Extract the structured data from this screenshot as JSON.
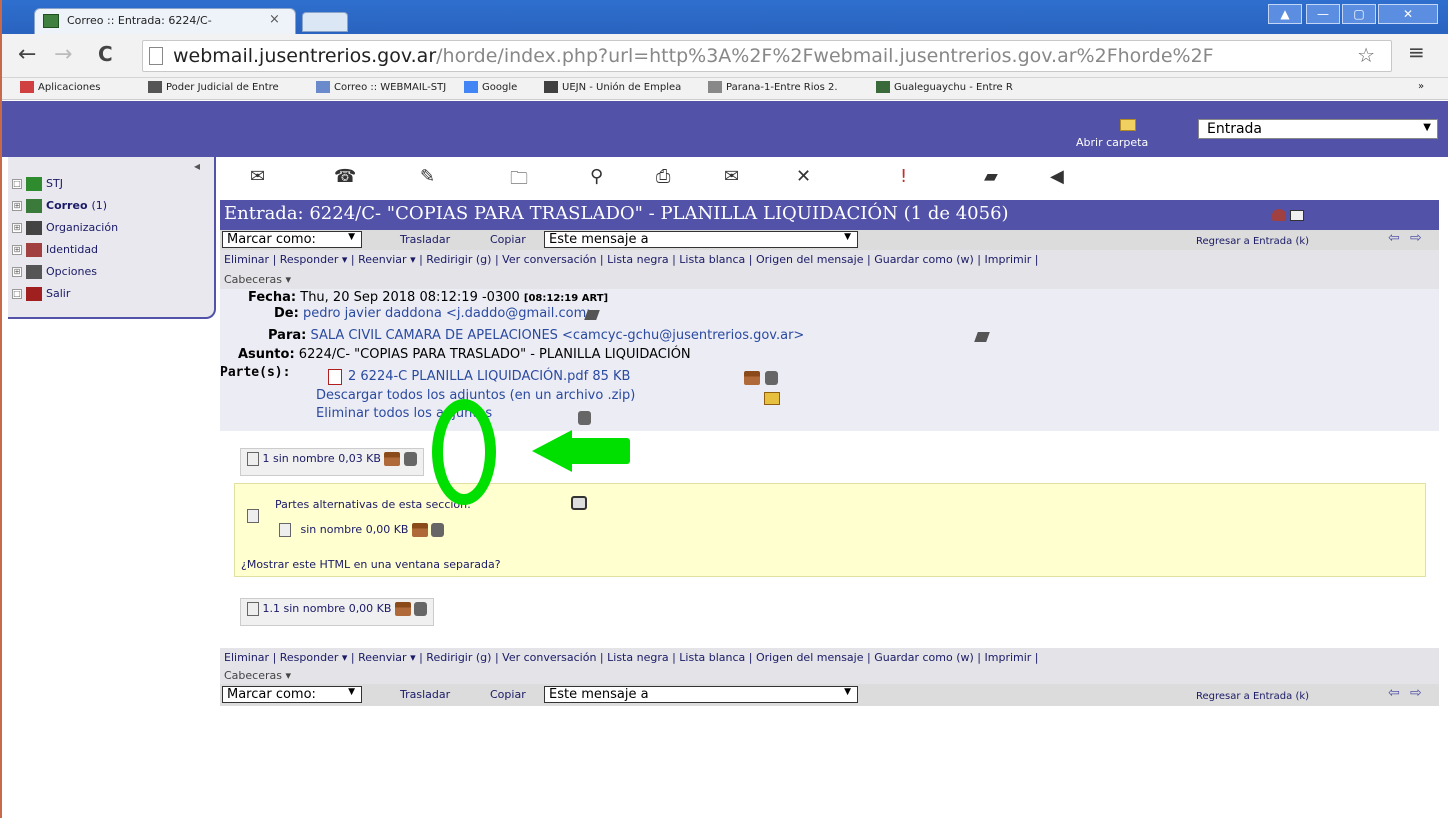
{
  "browser": {
    "tab_title": "Correo :: Entrada: 6224/C-",
    "tab_close": "×",
    "url_host": "webmail.jusentrerios.gov.ar",
    "url_rest": "/horde/index.php?url=http%3A%2F%2Fwebmail.jusentrerios.gov.ar%2Fhorde%2F",
    "back": "←",
    "forward": "→",
    "reload": "C",
    "star": "☆",
    "menu": "≡",
    "win_min": "—",
    "win_max": "▢",
    "win_close": "✕",
    "win_user": "▲"
  },
  "bookmarks": [
    {
      "label": "Aplicaciones",
      "color": "#d04040"
    },
    {
      "label": "Poder Judicial de Entre",
      "color": "#555555"
    },
    {
      "label": "Correo :: WEBMAIL-STJ",
      "color": "#6a8acb"
    },
    {
      "label": "Google",
      "color": "#4285f4"
    },
    {
      "label": "UEJN - Unión de Emplea",
      "color": "#404040"
    },
    {
      "label": "Parana-1-Entre Rios 2.",
      "color": "#888888"
    },
    {
      "label": "Gualeguaychu - Entre R",
      "color": "#3a6a3a"
    }
  ],
  "bookmarks_more": "»",
  "folder": {
    "open_label": "Abrir carpeta",
    "selected": "Entrada",
    "arrow": "▼"
  },
  "sidebar": {
    "items": [
      {
        "label": "STJ",
        "icon": "stj-icon",
        "toggle": "□"
      },
      {
        "label": "Correo",
        "count": "(1)",
        "icon": "mail-folder-icon",
        "toggle": "⊞"
      },
      {
        "label": "Organización",
        "icon": "organization-icon",
        "toggle": "⊞"
      },
      {
        "label": "Identidad",
        "icon": "identity-icon",
        "toggle": "⊞"
      },
      {
        "label": "Opciones",
        "icon": "options-icon",
        "toggle": "⊞"
      },
      {
        "label": "Salir",
        "icon": "logout-icon",
        "toggle": "□"
      }
    ]
  },
  "toolbar_icons": [
    "✉",
    "☎",
    "✎",
    "🗀",
    "⚲",
    "⎙",
    "✉",
    "✕",
    "!",
    "▰",
    "◀"
  ],
  "message": {
    "title": "Entrada: 6224/C- \"COPIAS PARA TRASLADO\" - PLANILLA LIQUIDACIÓN (1 de 4056)",
    "mark_as": "Marcar como:",
    "move": "Trasladar",
    "copy": "Copiar",
    "target": "Este mensaje a",
    "back_to": "Regresar a Entrada (k)",
    "prev": "⇦",
    "next": "⇨",
    "actions": "Eliminar | Responder ▾ | Reenviar ▾ | Redirigir (g) | Ver conversación | Lista negra | Lista blanca | Origen del mensaje | Guardar como (w) | Imprimir |",
    "headers_toggle": "Cabeceras ▾",
    "fecha_label": "Fecha:",
    "fecha": "Thu, 20 Sep 2018 08:12:19 -0300",
    "fecha_local": "[08:12:19 ART]",
    "de_label": "De:",
    "de": "pedro javier daddona <j.daddo@gmail.com>",
    "para_label": "Para:",
    "para": "SALA CIVIL CAMARA DE APELACIONES <camcyc-gchu@jusentrerios.gov.ar>",
    "asunto_label": "Asunto:",
    "asunto": "6224/C- \"COPIAS PARA TRASLADO\" - PLANILLA LIQUIDACIÓN",
    "partes_label": "Parte(s):",
    "attachment": "2 6224-C PLANILLA LIQUIDACIÓN.pdf 85 KB",
    "download_all": "Descargar todos los adjuntos (en un archivo .zip)",
    "delete_all": "Eliminar todos los adjuntos"
  },
  "parts": {
    "part1": "1 sin nombre 0,03 KB",
    "alt_label": "Partes alternativas de esta sección:",
    "alt_item": "sin nombre  0,00 KB",
    "show_html": "¿Mostrar este HTML en una ventana separada?",
    "part11": "1.1 sin nombre 0,00 KB"
  }
}
